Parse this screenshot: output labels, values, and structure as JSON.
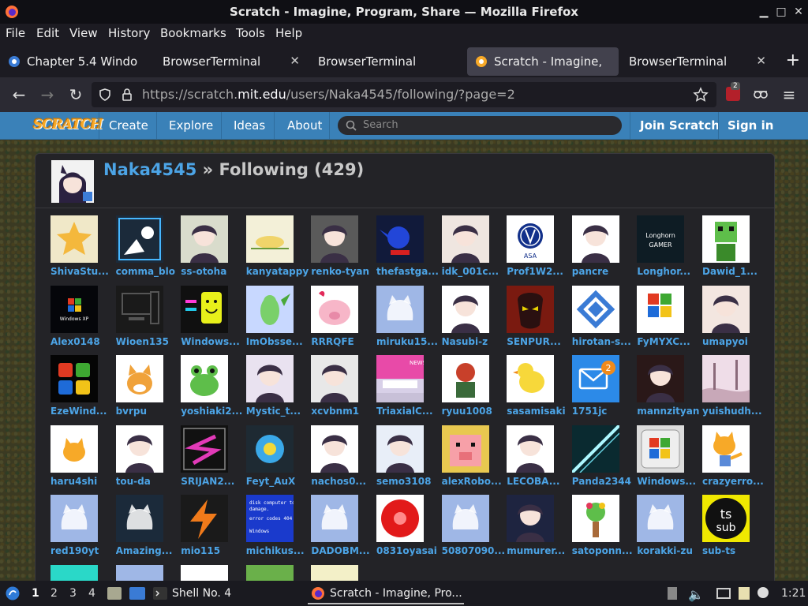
{
  "window": {
    "title": "Scratch - Imagine, Program, Share — Mozilla Firefox"
  },
  "menu": [
    "File",
    "Edit",
    "View",
    "History",
    "Bookmarks",
    "Tools",
    "Help"
  ],
  "tabs": [
    {
      "label": "Chapter 5.4 Windo",
      "active": false
    },
    {
      "label": "BrowserTerminal",
      "active": false
    },
    {
      "label": "BrowserTerminal",
      "active": false
    },
    {
      "label": "Scratch - Imagine,",
      "active": true
    },
    {
      "label": "BrowserTerminal",
      "active": false
    }
  ],
  "url": {
    "prefix": "https://scratch.",
    "domain": "mit.edu",
    "path": "/users/Naka4545/following/?page=2"
  },
  "toolbar": {
    "extension_badge": "2"
  },
  "scratch": {
    "logo": "SCRATCH",
    "nav": {
      "create": "Create",
      "explore": "Explore",
      "ideas": "Ideas",
      "about": "About",
      "join": "Join Scratch",
      "signin": "Sign in"
    },
    "search_placeholder": "Search",
    "profile": {
      "username": "Naka4545",
      "section": " » Following (429)"
    }
  },
  "following": [
    {
      "name": "ShivaStu...",
      "bg": "#f0e8c8",
      "art": "star"
    },
    {
      "name": "comma_blo",
      "bg": "#1b2a3a",
      "art": "frame"
    },
    {
      "name": "ss-otoha",
      "bg": "#d9dccc",
      "art": "person"
    },
    {
      "name": "kanyatappy",
      "bg": "#f3f0d8",
      "art": "bird"
    },
    {
      "name": "renko-tyan",
      "bg": "#5a5a5a",
      "art": "person"
    },
    {
      "name": "thefastga...",
      "bg": "#111a3a",
      "art": "sonic"
    },
    {
      "name": "idk_001c...",
      "bg": "#efe6e0",
      "art": "person"
    },
    {
      "name": "Prof1W2...",
      "bg": "#ffffff",
      "art": "asa"
    },
    {
      "name": "pancre",
      "bg": "#ffffff",
      "art": "person"
    },
    {
      "name": "Longhor...",
      "bg": "#0e1c24",
      "art": "longhorn"
    },
    {
      "name": "Dawid_1...",
      "bg": "#ffffff",
      "art": "creeper"
    },
    {
      "name": "Alex0148",
      "bg": "#05060a",
      "art": "winxp"
    },
    {
      "name": "Wioen135",
      "bg": "#1a1a1a",
      "art": "computer"
    },
    {
      "name": "Windows...",
      "bg": "#101010",
      "art": "smile"
    },
    {
      "name": "ImObsse...",
      "bg": "#c8d8ff",
      "art": "parrot"
    },
    {
      "name": "RRRQFE",
      "bg": "#ffffff",
      "art": "pig"
    },
    {
      "name": "miruku15...",
      "bg": "#9fb7e6",
      "art": "cat"
    },
    {
      "name": "Nasubi-z",
      "bg": "#ffffff",
      "art": "person"
    },
    {
      "name": "SENPUR...",
      "bg": "#7a1a10",
      "art": "mask"
    },
    {
      "name": "hirotan-s...",
      "bg": "#ffffff",
      "art": "tiles"
    },
    {
      "name": "FyMYXC...",
      "bg": "#ffffff",
      "art": "win95"
    },
    {
      "name": "umapyoi",
      "bg": "#f3e6e0",
      "art": "person"
    },
    {
      "name": "EzeWind...",
      "bg": "#050505",
      "art": "winlogo"
    },
    {
      "name": "bvrpu",
      "bg": "#ffffff",
      "art": "doge"
    },
    {
      "name": "yoshiaki2...",
      "bg": "#ffffff",
      "art": "frog"
    },
    {
      "name": "Mystic_t...",
      "bg": "#e9e2f0",
      "art": "person"
    },
    {
      "name": "xcvbnm1",
      "bg": "#e8e8e8",
      "art": "person"
    },
    {
      "name": "TriaxialC...",
      "bg": "#d8d0e8",
      "art": "news"
    },
    {
      "name": "ryuu1008",
      "bg": "#ffffff",
      "art": "ganon"
    },
    {
      "name": "sasamisaki",
      "bg": "#ffffff",
      "art": "chick"
    },
    {
      "name": "1751jc",
      "bg": "#2c8ae8",
      "art": "mail"
    },
    {
      "name": "mannzityan",
      "bg": "#2a1818",
      "art": "person"
    },
    {
      "name": "yuishudh...",
      "bg": "#efdde8",
      "art": "trees"
    },
    {
      "name": "haru4shi",
      "bg": "#ffffff",
      "art": "scratchcat"
    },
    {
      "name": "tou-da",
      "bg": "#ffffff",
      "art": "person"
    },
    {
      "name": "SRIJAN2...",
      "bg": "#111111",
      "art": "slogo"
    },
    {
      "name": "Feyt_AuX",
      "bg": "#1e2a33",
      "art": "flower"
    },
    {
      "name": "nachos0...",
      "bg": "#ffffff",
      "art": "person"
    },
    {
      "name": "semo3108",
      "bg": "#e8eef8",
      "art": "person"
    },
    {
      "name": "alexRobo...",
      "bg": "#e8c850",
      "art": "pigface"
    },
    {
      "name": "LECOBA...",
      "bg": "#ffffff",
      "art": "person"
    },
    {
      "name": "Panda2344",
      "bg": "#0a2a30",
      "art": "light"
    },
    {
      "name": "Windows...",
      "bg": "#dcdcdc",
      "art": "winxplogo"
    },
    {
      "name": "crazyerro...",
      "bg": "#ffffff",
      "art": "scratchcat2"
    },
    {
      "name": "red190yt",
      "bg": "#9fb7e6",
      "art": "cat"
    },
    {
      "name": "Amazing...",
      "bg": "#1b2a3a",
      "art": "cat"
    },
    {
      "name": "mio115",
      "bg": "#1a1a1a",
      "art": "bolt"
    },
    {
      "name": "michikus...",
      "bg": "#1a3acc",
      "art": "bsod"
    },
    {
      "name": "DADOBM...",
      "bg": "#9fb7e6",
      "art": "cat"
    },
    {
      "name": "0831oyasai",
      "bg": "#ffffff",
      "art": "sun"
    },
    {
      "name": "50807090...",
      "bg": "#9fb7e6",
      "art": "cat"
    },
    {
      "name": "mumurer...",
      "bg": "#1e2440",
      "art": "person"
    },
    {
      "name": "satoponn...",
      "bg": "#ffffff",
      "art": "plant"
    },
    {
      "name": "korakki-zu",
      "bg": "#9fb7e6",
      "art": "cat"
    },
    {
      "name": "sub-ts",
      "bg": "#f0e800",
      "art": "tssub"
    },
    {
      "name": "",
      "bg": "#2ad8c8",
      "art": "none"
    },
    {
      "name": "",
      "bg": "#9fb7e6",
      "art": "none"
    },
    {
      "name": "",
      "bg": "#ffffff",
      "art": "none"
    },
    {
      "name": "",
      "bg": "#6ab04a",
      "art": "none"
    },
    {
      "name": "",
      "bg": "#f3f0c8",
      "art": "none"
    }
  ],
  "art_text": {
    "longhorn": "Longhorn GAMER",
    "asa": "ASA",
    "tssub_top": "ts",
    "tssub_bottom": "sub",
    "bsod": "disk computer to damage error codes 404 ...what? Windows Explorer Microsoft",
    "news": "NEWS",
    "winxp": "Windows XP"
  },
  "taskbar": {
    "workspaces": [
      "1",
      "2",
      "3",
      "4"
    ],
    "apps": [
      {
        "label": "Shell No. 4",
        "active": false
      },
      {
        "label": "Scratch - Imagine, Pro...",
        "active": true
      }
    ],
    "clock": "1:21"
  }
}
